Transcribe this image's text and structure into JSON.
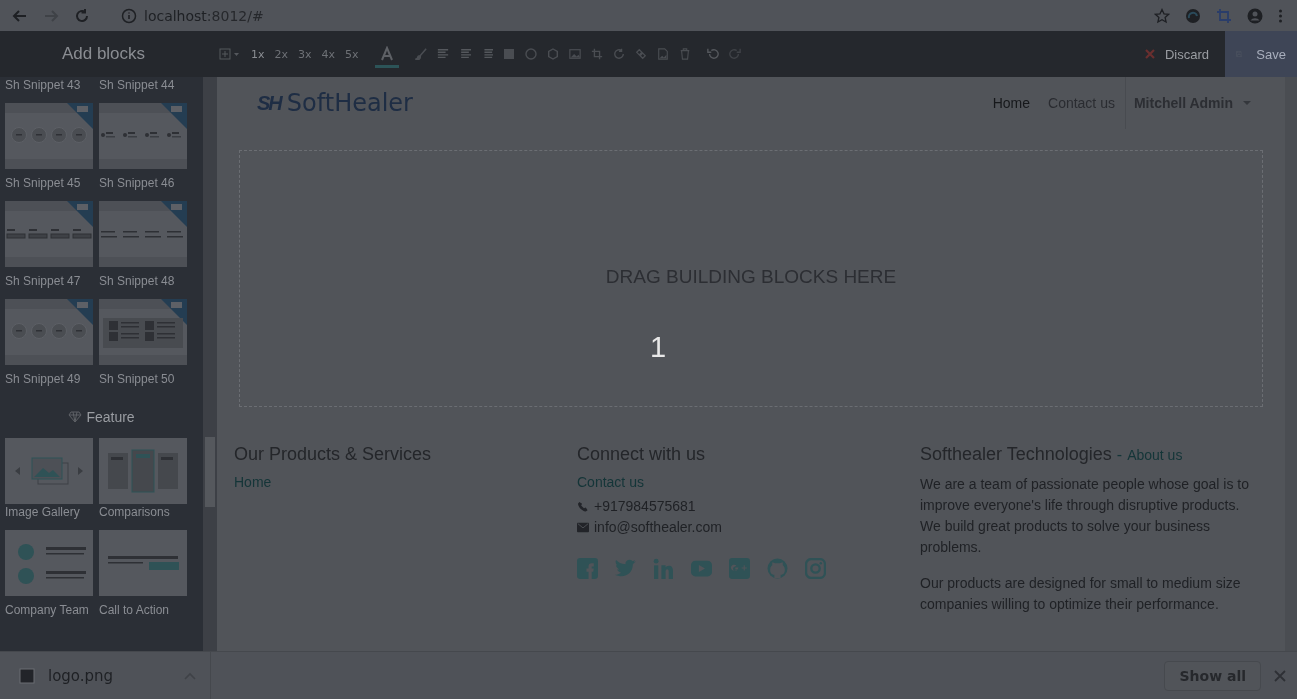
{
  "browser": {
    "host": "localhost",
    "path": ":8012/#"
  },
  "editor_toolbar": {
    "title": "Add blocks",
    "sizes": [
      "1x",
      "2x",
      "3x",
      "4x",
      "5x"
    ],
    "discard": "Discard",
    "save": "Save"
  },
  "sidebar": {
    "snippets": [
      {
        "label": "Sh Snippet 43",
        "kind": "label-only"
      },
      {
        "label": "Sh Snippet 44",
        "kind": "label-only"
      },
      {
        "label": "Sh Snippet 45",
        "kind": "circles"
      },
      {
        "label": "Sh Snippet 46",
        "kind": "icon-rows"
      },
      {
        "label": "Sh Snippet 47",
        "kind": "boxes"
      },
      {
        "label": "Sh Snippet 48",
        "kind": "lines"
      },
      {
        "label": "Sh Snippet 49",
        "kind": "circles"
      },
      {
        "label": "Sh Snippet 50",
        "kind": "cards"
      }
    ],
    "section": "Feature",
    "features": [
      {
        "label": "Image Gallery",
        "kind": "gallery"
      },
      {
        "label": "Comparisons",
        "kind": "comparisons"
      },
      {
        "label": "Company Team",
        "kind": "team"
      },
      {
        "label": "Call to Action",
        "kind": "cta"
      }
    ]
  },
  "page": {
    "logo_mark": "SH",
    "logo": "SoftHealer",
    "nav": [
      {
        "label": "Home",
        "selected": true
      },
      {
        "label": "Contact us",
        "selected": false
      }
    ],
    "user": "Mitchell Admin",
    "dropzone": "DRAG BUILDING BLOCKS HERE",
    "overlay_number": "1",
    "footer": {
      "products_title": "Our Products & Services",
      "products_link": "Home",
      "connect_title": "Connect with us",
      "connect_link": "Contact us",
      "phone": "+917984575681",
      "email": "info@softhealer.com",
      "about_title": "Softhealer Technologies",
      "about_sep": "-",
      "about_link": "About us",
      "about_text": [
        "We are a team of passionate people whose goal is to improve everyone's life through disruptive products. We build great products to solve your business problems.",
        "Our products are designed for small to medium size companies willing to optimize their performance."
      ]
    }
  },
  "downloads": {
    "file": "logo.png",
    "show_all": "Show all"
  }
}
